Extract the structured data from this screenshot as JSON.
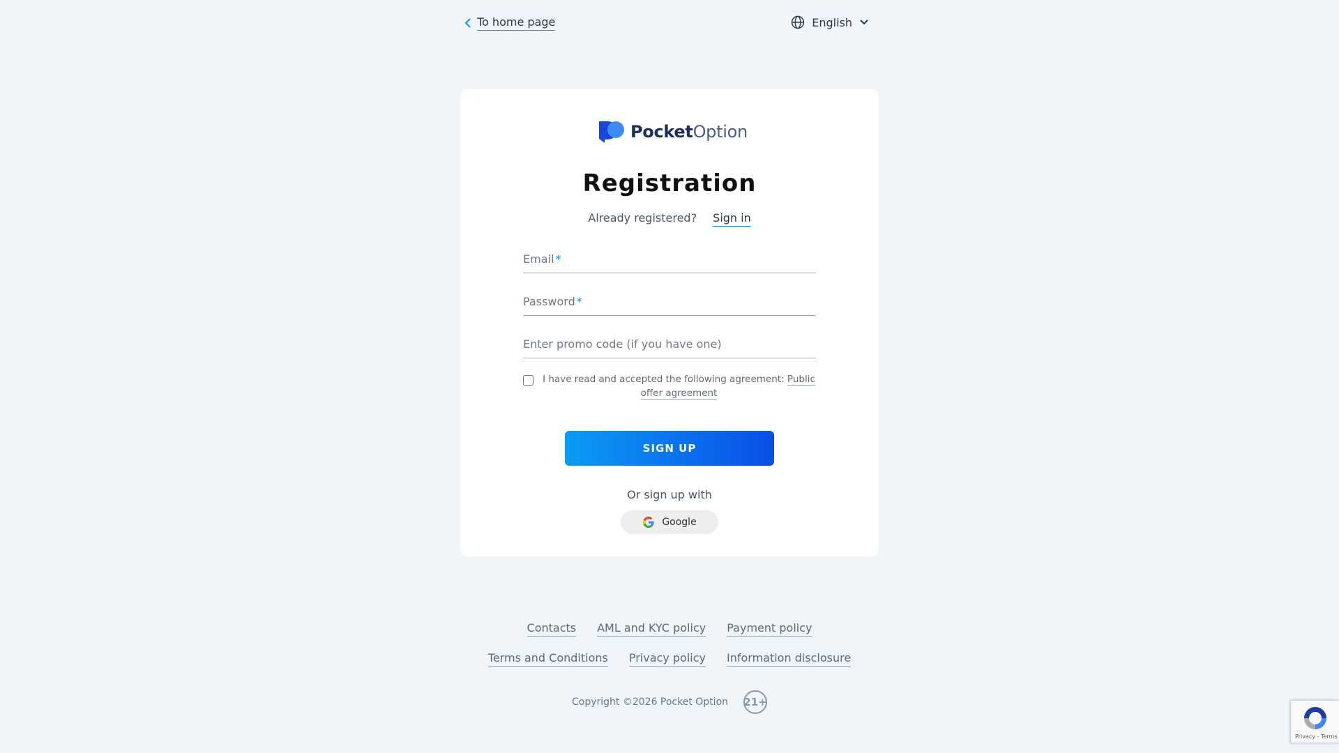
{
  "topbar": {
    "back_label": "To home page",
    "language": "English"
  },
  "brand": {
    "name_bold": "Pocket",
    "name_light": "Option",
    "color_primary": "#1a47d9",
    "color_secondary": "#3d8bf5"
  },
  "form": {
    "title": "Registration",
    "already_registered": "Already registered?",
    "sign_in_label": "Sign in",
    "email_label": "Email",
    "password_label": "Password",
    "required_mark": "*",
    "promo_placeholder": "Enter promo code (if you have one)",
    "agreement_text": "I have read and accepted the following agreement:",
    "agreement_link": "Public offer agreement",
    "signup_label": "SIGN UP",
    "or_sign_up_with": "Or sign up with",
    "google_label": "Google"
  },
  "footer": {
    "links_row1": [
      "Contacts",
      "AML and KYC policy",
      "Payment policy"
    ],
    "links_row2": [
      "Terms and Conditions",
      "Privacy policy",
      "Information disclosure"
    ],
    "copyright": "Copyright ©2026 Pocket Option",
    "age_badge": "21+"
  },
  "recaptcha": {
    "text": "Privacy - Terms"
  }
}
